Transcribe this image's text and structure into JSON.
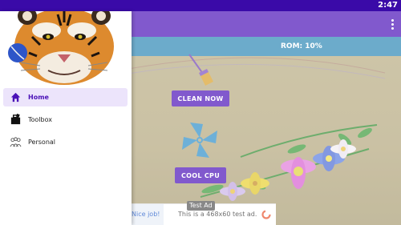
{
  "status_bar": {
    "time": "2:47"
  },
  "app_bar": {
    "menu_icon": "overflow-menu-icon"
  },
  "main": {
    "storage_label": "ROM: 10%",
    "clean_button": "CLEAN NOW",
    "cool_button": "COOL CPU",
    "icons": [
      "broom-icon",
      "fan-icon"
    ]
  },
  "ad": {
    "label": "Test Ad",
    "left_text": "Nice job!",
    "text": "This is a 468x60 test ad."
  },
  "drawer": {
    "header_image": "tiger-image",
    "items": [
      {
        "label": "Home",
        "icon": "home-icon",
        "active": true
      },
      {
        "label": "Toolbox",
        "icon": "toolbox-icon",
        "active": false
      },
      {
        "label": "Personal",
        "icon": "personal-icon",
        "active": false
      }
    ]
  },
  "colors": {
    "primary": "#4b12b8",
    "status_bar": "#3a0aa8",
    "rom_bar": "#2d87b5",
    "background": "#b4a77d",
    "active_item_bg": "#ece4fb"
  }
}
